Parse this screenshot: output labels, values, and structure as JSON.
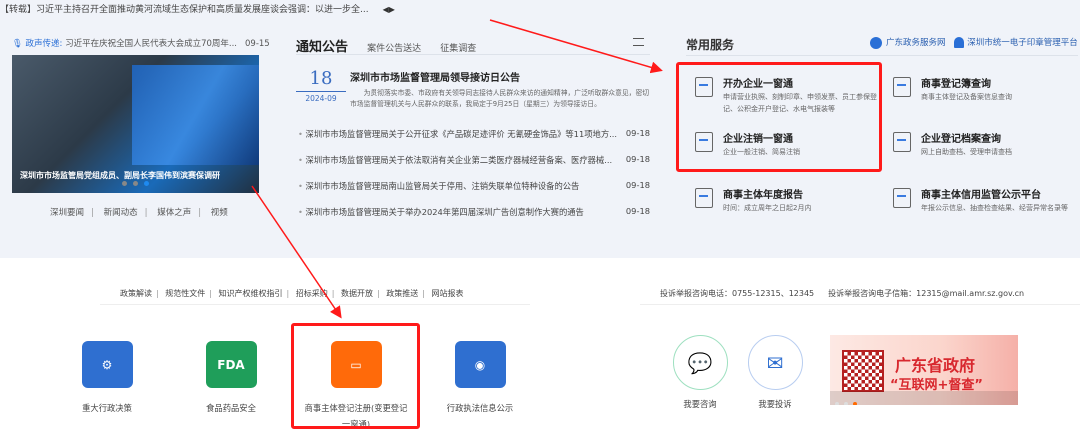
{
  "ticker": {
    "text": "【转载】习近平主持召开全面推动黄河流域生态保护和高质量发展座谈会强调：以进一步全...",
    "arrows": "◀▶"
  },
  "voice": {
    "label": "政声传递:",
    "text": "习近平在庆祝全国人民代表大会成立70周年...",
    "date": "09-15"
  },
  "carousel": {
    "caption": "深圳市市场监管局党组成员、副局长李国伟到滨赛保调研",
    "active_dot": 3
  },
  "news_links": [
    "深圳要闻",
    "新闻动态",
    "媒体之声",
    "视频"
  ],
  "notice": {
    "title": "通知公告",
    "tabs": [
      "案件公告送达",
      "征集调查"
    ],
    "featured": {
      "day": "18",
      "year_month": "2024-09",
      "title": "深圳市市场监督管理局领导接访日公告",
      "text": "为贯彻落实市委、市政府有关领导同志接待人民群众来访的通知精神，广泛听取群众意见，密切市场监督管理机关与人民群众的联系，我局定于9月25日（星期三）为领导接访日。"
    },
    "items": [
      {
        "title": "深圳市市场监督管理局关于公开征求《产品碳足迹评价 无氰硬金饰品》等11项地方...",
        "date": "09-18"
      },
      {
        "title": "深圳市市场监督管理局关于依法取消有关企业第二类医疗器械经营备案、医疗器械...",
        "date": "09-18"
      },
      {
        "title": "深圳市市场监督管理局南山监管局关于停用、注销失联单位特种设备的公告",
        "date": "09-18"
      },
      {
        "title": "深圳市市场监督管理局关于举办2024年第四届深圳广告创意制作大赛的通告",
        "date": "09-18"
      }
    ]
  },
  "services": {
    "title": "常用服务",
    "links": [
      "广东政务服务网",
      "深圳市统一电子印章管理平台"
    ],
    "items": [
      {
        "name": "开办企业一窗通",
        "desc": "申请营业执照、刻制印章、申领发票、员工参保登记、公积金开户登记、水电气报装等"
      },
      {
        "name": "商事登记簿查询",
        "desc": "商事主体登记及备案信息查询"
      },
      {
        "name": "企业注销一窗通",
        "desc": "企业一般注销、简易注销"
      },
      {
        "name": "企业登记档案查询",
        "desc": "网上自助查档、受理申请查档"
      },
      {
        "name": "商事主体年度报告",
        "desc": "时间：成立周年之日起2月内"
      },
      {
        "name": "商事主体信用监管公示平台",
        "desc": "年报公示信息、抽查检查结果、经营异常名录等"
      }
    ]
  },
  "footer_links": [
    "政策解读",
    "规范性文件",
    "知识产权维权指引",
    "招标采购",
    "数据开放",
    "政策推送",
    "网站报表"
  ],
  "complaint": {
    "phone": "投诉举报咨询电话：0755-12315、12345",
    "email": "投诉举报咨询电子信箱：12315@mail.amr.sz.gov.cn"
  },
  "tiles": [
    {
      "label": "重大行政决策",
      "color": "#2f6fd0",
      "icon": "people-gear-icon"
    },
    {
      "label": "食品药品安全",
      "color": "#1f9e5a",
      "icon": "fda-icon",
      "glyph": "FDA"
    },
    {
      "label": "商事主体登记注册(变更登记一窗通)",
      "color": "#ff6a0a",
      "icon": "monitor-icon"
    },
    {
      "label": "行政执法信息公示",
      "color": "#2f6fd0",
      "icon": "badge-icon"
    }
  ],
  "circles": [
    {
      "label": "我要咨询",
      "icon": "chat-icon"
    },
    {
      "label": "我要投诉",
      "icon": "envelope-pen-icon"
    }
  ],
  "banner": {
    "line1": "广东省政府",
    "line2": "“互联网+督查”"
  },
  "colors": {
    "highlight": "#ff1a1a",
    "accent": "#2a6fd6"
  }
}
